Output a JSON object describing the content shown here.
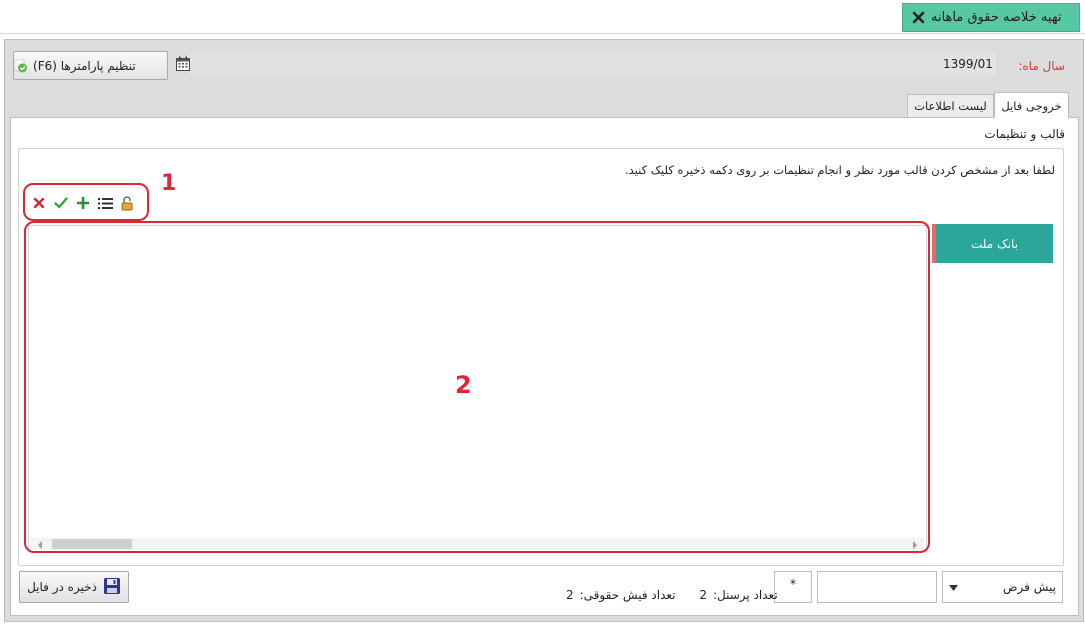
{
  "window_tab": {
    "title": "تهیه خلاصه حقوق ماهانه",
    "close_icon": "close-icon"
  },
  "header": {
    "year_month_label": "سال ماه:",
    "year_month_value": "1399/01",
    "settings_button": "تنظیم پارامترها (F6)"
  },
  "tabs": [
    {
      "label": "خروجی فایل",
      "active": true
    },
    {
      "label": "لیست اطلاعات",
      "active": false
    }
  ],
  "section": {
    "title": "قالب و تنظیمات",
    "instruction": "لطفا بعد از مشخص کردن قالب مورد نظر و انجام تنظیمات بر روی دکمه ذخیره کلیک کنید."
  },
  "toolbar": {
    "icons": [
      "close-icon",
      "check-icon",
      "plus-icon",
      "list-icon",
      "lock-icon"
    ],
    "annotation": "1"
  },
  "grid": {
    "annotation": "2"
  },
  "banks": [
    {
      "name": "بانک ملت"
    }
  ],
  "footer": {
    "format_select": "پیش فرض",
    "field_2_value": "*",
    "personnel_count_label": "تعداد پرسنل:",
    "personnel_count": "2",
    "payslip_count_label": "تعداد فیش حقوقی:",
    "payslip_count": "2",
    "save_button": "ذخیره در فایل"
  },
  "colors": {
    "tab_accent": "#58c8a3",
    "bank_item": "#2aa79a",
    "annotation_red": "#d8283a",
    "label_red": "#d63a3a"
  }
}
